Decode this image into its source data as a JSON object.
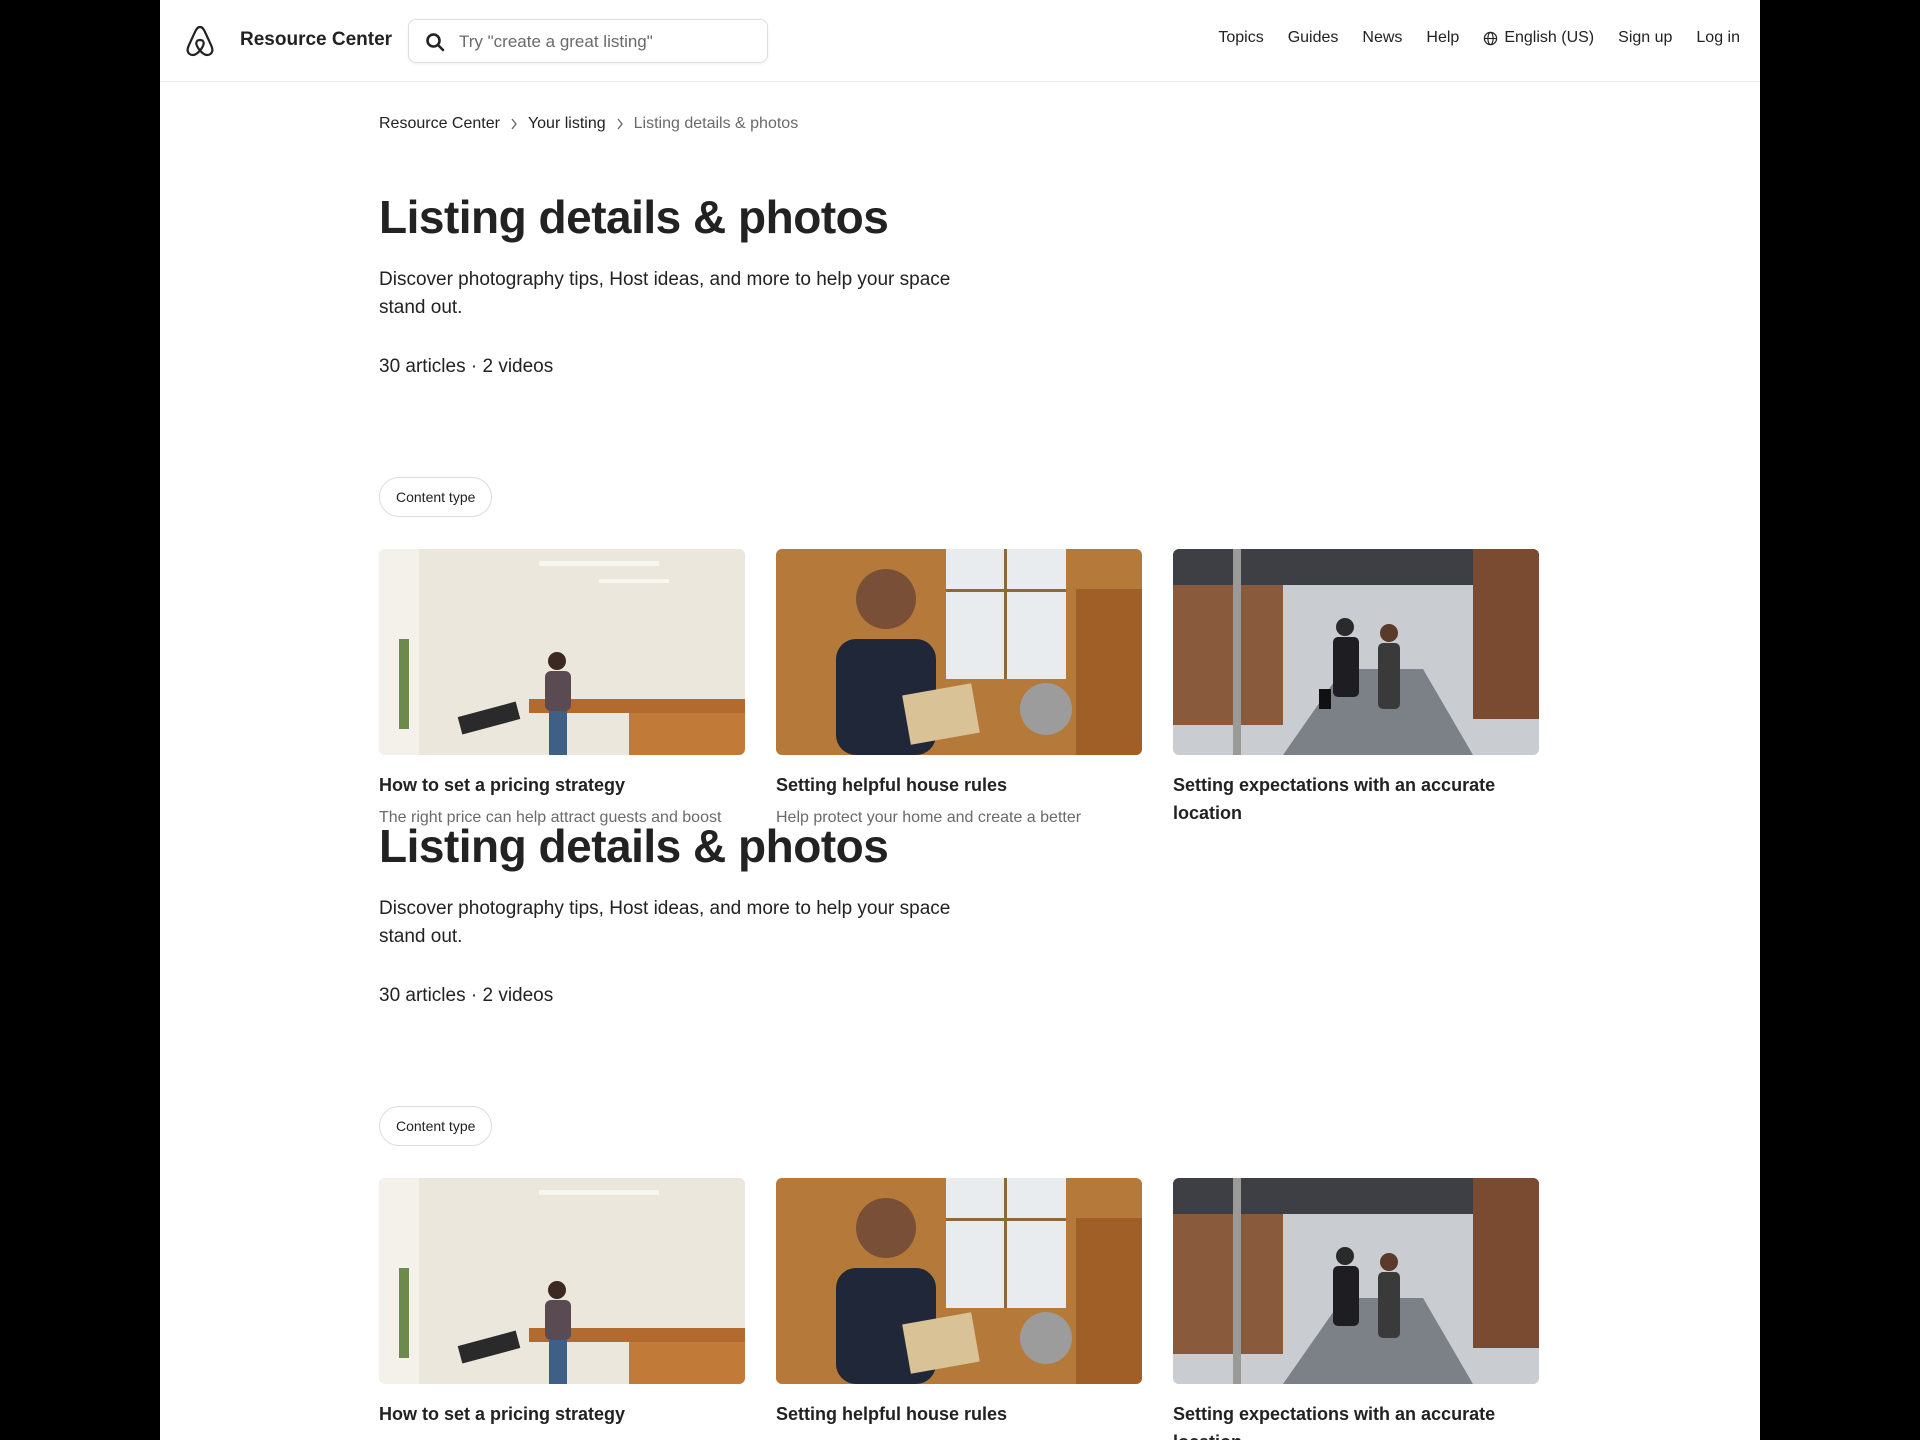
{
  "header": {
    "brand": "Resource Center",
    "search_placeholder": "Try \"create a great listing\"",
    "nav": {
      "topics": "Topics",
      "guides": "Guides",
      "news": "News",
      "help": "Help",
      "language": "English (US)",
      "signup": "Sign up",
      "login": "Log in"
    }
  },
  "breadcrumb": {
    "items": [
      "Resource Center",
      "Your listing",
      "Listing details & photos"
    ]
  },
  "main": {
    "title": "Listing details & photos",
    "description": "Discover photography tips, Host ideas, and more to help your space stand out.",
    "counts": "30 articles · 2 videos",
    "filter_chip": "Content type",
    "cards": [
      {
        "title": "How to set a pricing strategy",
        "subtitle": "The right price can help attract guests and boost"
      },
      {
        "title": "Setting helpful house rules",
        "subtitle": "Help protect your home and create a better"
      },
      {
        "title": "Setting expectations with an accurate location",
        "subtitle": ""
      }
    ]
  },
  "colors": {
    "text": "#222222",
    "muted": "#6a6a6a",
    "border": "#dddddd",
    "page_margin": "#000000"
  }
}
